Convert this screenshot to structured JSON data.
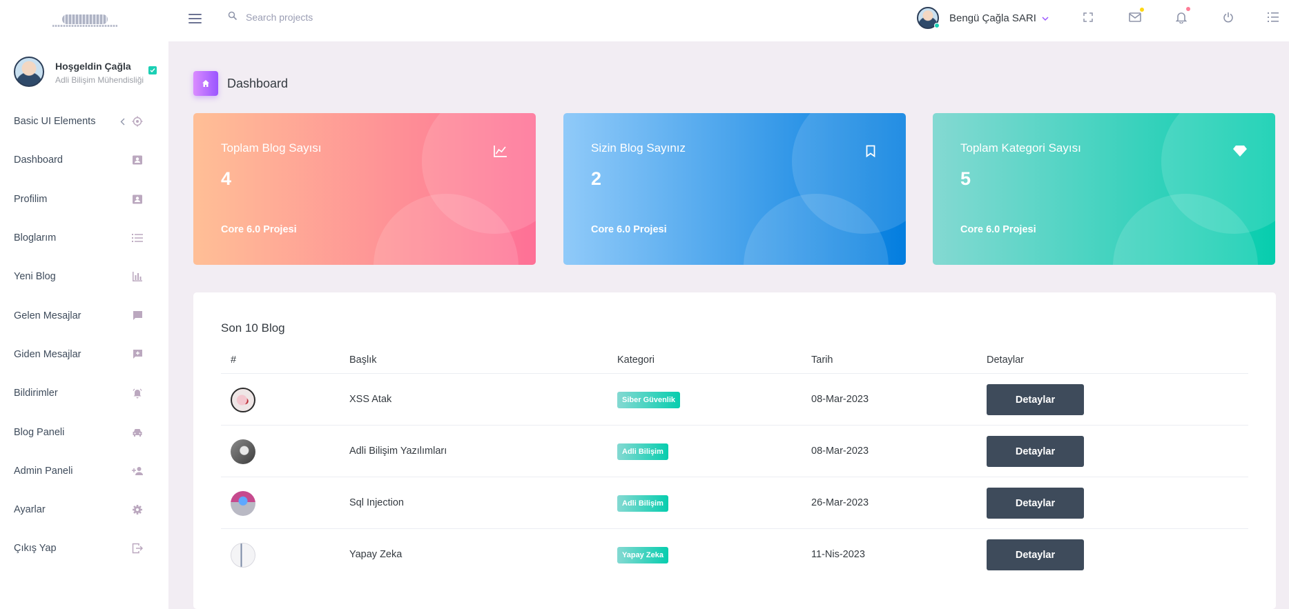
{
  "search": {
    "placeholder": "Search projects"
  },
  "topbar": {
    "user_name": "Bengü Çağla SARI"
  },
  "sidebar": {
    "greeting": "Hoşgeldin Çağla",
    "department": "Adli Bilişim Mühendisliği",
    "items": [
      {
        "label": "Basic UI Elements",
        "icon": "crosshairs-icon"
      },
      {
        "label": "Dashboard",
        "icon": "contacts-icon"
      },
      {
        "label": "Profilim",
        "icon": "contacts-icon"
      },
      {
        "label": "Bloglarım",
        "icon": "format-list-icon"
      },
      {
        "label": "Yeni Blog",
        "icon": "chart-bar-icon"
      },
      {
        "label": "Gelen Mesajlar",
        "icon": "message-icon"
      },
      {
        "label": "Giden Mesajlar",
        "icon": "message-plus-icon"
      },
      {
        "label": "Bildirimler",
        "icon": "bell-ring-icon"
      },
      {
        "label": "Blog Paneli",
        "icon": "car-icon"
      },
      {
        "label": "Admin Paneli",
        "icon": "account-plus-icon"
      },
      {
        "label": "Ayarlar",
        "icon": "gear-icon"
      },
      {
        "label": "Çıkış Yap",
        "icon": "logout-icon"
      }
    ]
  },
  "page": {
    "title": "Dashboard"
  },
  "cards": [
    {
      "title": "Toplam Blog Sayısı",
      "value": "4",
      "footer": "Core 6.0 Projesi",
      "icon": "chart-line-icon"
    },
    {
      "title": "Sizin Blog Sayınız",
      "value": "2",
      "footer": "Core 6.0 Projesi",
      "icon": "bookmark-icon"
    },
    {
      "title": "Toplam Kategori Sayısı",
      "value": "5",
      "footer": "Core 6.0 Projesi",
      "icon": "diamond-icon"
    }
  ],
  "table": {
    "title": "Son 10 Blog",
    "headers": [
      "#",
      "Başlık",
      "Kategori",
      "Tarih",
      "Detaylar"
    ],
    "rows": [
      {
        "title": "XSS Atak",
        "category": "Siber Güvenlik",
        "date": "08-Mar-2023",
        "action": "Detaylar"
      },
      {
        "title": "Adli Bilişim Yazılımları",
        "category": "Adli Bilişim",
        "date": "08-Mar-2023",
        "action": "Detaylar"
      },
      {
        "title": "Sql Injection",
        "category": "Adli Bilişim",
        "date": "26-Mar-2023",
        "action": "Detaylar"
      },
      {
        "title": "Yapay Zeka",
        "category": "Yapay Zeka",
        "date": "11-Nis-2023",
        "action": "Detaylar"
      }
    ]
  },
  "colors": {
    "sidebar_icon": "#b66dff",
    "button_dark": "#3e4b5b",
    "badge_success": "#1bcfb4",
    "mail_dot": "#fed713",
    "bell_dot": "#fe7c96"
  }
}
